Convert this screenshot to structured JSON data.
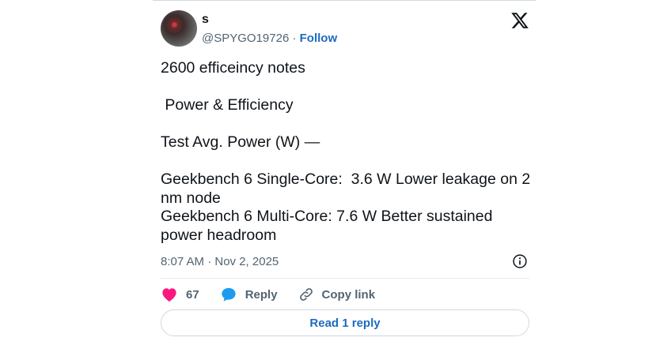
{
  "author": {
    "name": "s",
    "handle": "@SPYGO19726",
    "separator": " · ",
    "follow_label": "Follow"
  },
  "brand": {
    "icon": "x-logo-icon"
  },
  "tweet": {
    "lines": [
      "2600 efficeincy notes",
      "",
      " Power & Efficiency",
      "",
      "Test Avg. Power (W) —",
      "",
      "Geekbench 6 Single-Core:  3.6 W Lower leakage on 2 nm node",
      "Geekbench 6 Multi-Core: 7.6 W Better sustained power headroom"
    ],
    "timestamp": "8:07 AM · Nov 2, 2025"
  },
  "actions": {
    "like_count": "67",
    "reply_label": "Reply",
    "copy_link_label": "Copy link"
  },
  "read_replies_label": "Read 1 reply",
  "colors": {
    "link": "#1d6bc0",
    "like": "#f91880",
    "reply_icon": "#1d9bf0",
    "muted": "#536471"
  }
}
